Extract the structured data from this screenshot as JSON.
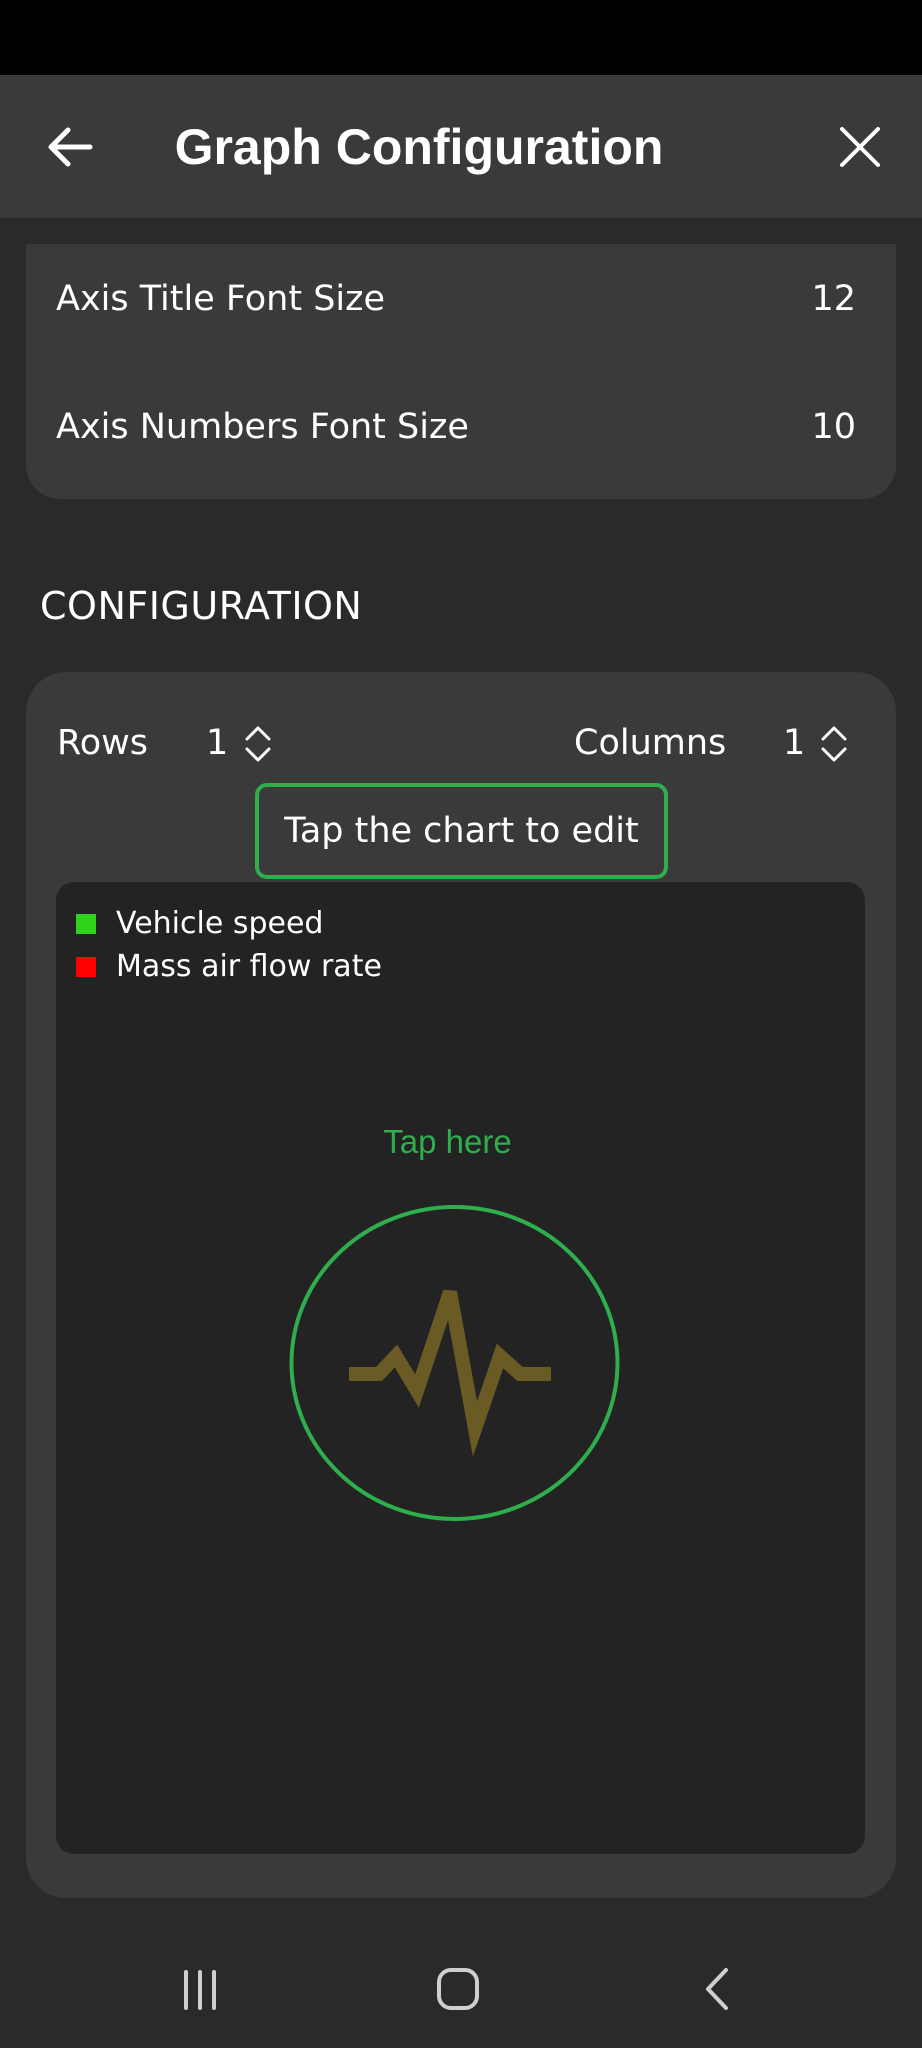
{
  "app_bar": {
    "title": "Graph Configuration",
    "back_icon": "arrow-left-icon",
    "close_icon": "close-icon"
  },
  "font_settings": {
    "items": [
      {
        "label": "Axis Title Font Size",
        "value": "12"
      },
      {
        "label": "Axis Numbers Font Size",
        "value": "10"
      }
    ]
  },
  "configuration": {
    "header": "CONFIGURATION",
    "rows": {
      "label": "Rows",
      "value": "1"
    },
    "columns": {
      "label": "Columns",
      "value": "1"
    },
    "hint": "Tap the chart to edit",
    "chart": {
      "legend": [
        {
          "label": "Vehicle speed",
          "color": "#2fd31c"
        },
        {
          "label": "Mass air flow rate",
          "color": "#ff0000"
        }
      ],
      "tap_label": "Tap here",
      "accent_color": "#2fae4e",
      "pulse_color": "#6a5a24"
    }
  },
  "nav_bar": {
    "recents_icon": "recents-icon",
    "home_icon": "home-icon",
    "back_icon": "back-chevron-icon"
  }
}
